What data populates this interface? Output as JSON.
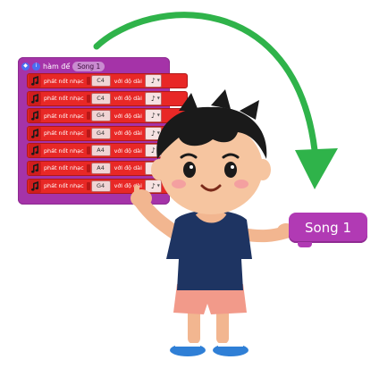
{
  "function_block": {
    "header_label": "hàm để",
    "header_name": "Song 1",
    "row_label": "phát nốt nhạc",
    "duration_label": "với độ dài",
    "notes": [
      "C4",
      "C4",
      "G4",
      "G4",
      "A4",
      "A4",
      "G4"
    ],
    "duration_symbol": "♪"
  },
  "song_block": {
    "label": "Song 1"
  },
  "colors": {
    "function_purple": "#a533a8",
    "note_red": "#e82826",
    "arrow_green": "#2fb34a",
    "song_purple": "#b13ab4"
  },
  "icons": [
    "music-note-icon",
    "green-arrow",
    "boy-illustration"
  ]
}
